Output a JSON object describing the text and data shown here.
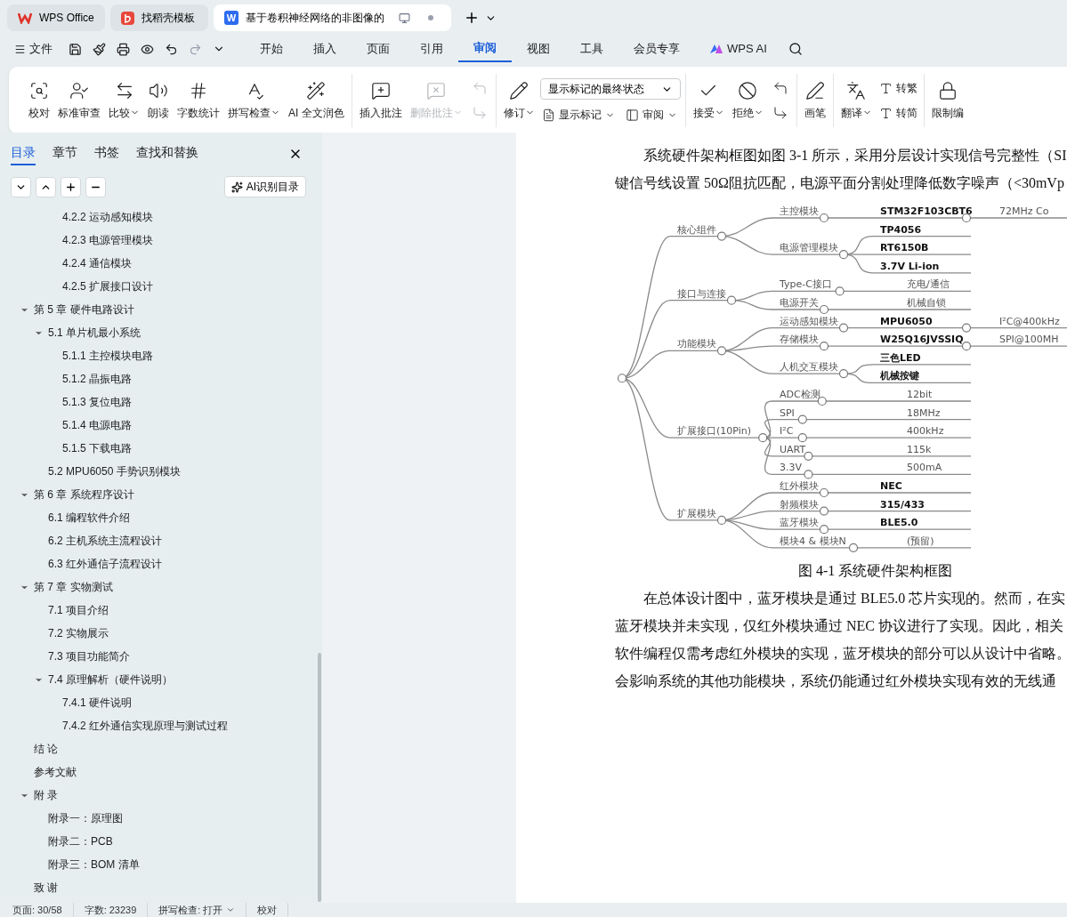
{
  "app_tabs": [
    {
      "kind": "wps",
      "label": "WPS Office",
      "selected": false
    },
    {
      "kind": "template",
      "label": "找稻壳模板",
      "selected": false
    },
    {
      "kind": "doc",
      "badge": "W",
      "label": "基于卷积神经网络的非图像的",
      "selected": true
    }
  ],
  "menu": {
    "file": "文件",
    "items": [
      {
        "label": "开始",
        "selected": false
      },
      {
        "label": "插入",
        "selected": false
      },
      {
        "label": "页面",
        "selected": false
      },
      {
        "label": "引用",
        "selected": false
      },
      {
        "label": "审阅",
        "selected": true
      },
      {
        "label": "视图",
        "selected": false
      },
      {
        "label": "工具",
        "selected": false
      },
      {
        "label": "会员专享",
        "selected": false
      }
    ],
    "ai": "WPS AI"
  },
  "ribbon": [
    {
      "items": [
        {
          "kind": "large",
          "label": "校对",
          "dropdown": false,
          "disabled": false
        },
        {
          "kind": "large",
          "label": "标准审查",
          "dropdown": false,
          "disabled": false
        },
        {
          "kind": "large",
          "label": "比较",
          "dropdown": true,
          "disabled": false
        },
        {
          "kind": "large",
          "label": "朗读",
          "dropdown": false,
          "disabled": false
        },
        {
          "kind": "large",
          "label": "字数统计",
          "dropdown": false,
          "disabled": false
        },
        {
          "kind": "large",
          "label": "拼写检查",
          "dropdown": true,
          "disabled": false
        },
        {
          "kind": "large",
          "label": "AI 全文润色",
          "dropdown": false,
          "disabled": false
        }
      ]
    },
    {
      "items": [
        {
          "kind": "large",
          "label": "插入批注",
          "dropdown": false,
          "disabled": false
        },
        {
          "kind": "large",
          "label": "删除批注",
          "dropdown": true,
          "disabled": true
        },
        {
          "kind": "pair",
          "disabled": true
        }
      ]
    },
    {
      "items": [
        {
          "kind": "large",
          "label": "修订",
          "dropdown": true,
          "disabled": false
        },
        {
          "kind": "select",
          "value": "显示标记的最终状态",
          "buttons": [
            {
              "label": "显示标记",
              "dropdown": true
            },
            {
              "label": "审阅",
              "dropdown": true
            }
          ]
        }
      ]
    },
    {
      "items": [
        {
          "kind": "large",
          "label": "接受",
          "dropdown": true,
          "disabled": false
        },
        {
          "kind": "large",
          "label": "拒绝",
          "dropdown": true,
          "disabled": false
        },
        {
          "kind": "pair",
          "disabled": false
        }
      ]
    },
    {
      "items": [
        {
          "kind": "large",
          "label": "画笔",
          "dropdown": false,
          "disabled": false
        }
      ]
    },
    {
      "items": [
        {
          "kind": "large",
          "label": "翻译",
          "dropdown": true,
          "disabled": false
        },
        {
          "kind": "stack",
          "buttons": [
            {
              "label": "转繁",
              "dropdown": false
            },
            {
              "label": "转简",
              "dropdown": false
            }
          ]
        }
      ]
    },
    {
      "items": [
        {
          "kind": "large",
          "label": "限制编",
          "dropdown": false,
          "disabled": false
        }
      ]
    }
  ],
  "sidebar": {
    "tabs": [
      {
        "label": "目录",
        "selected": true
      },
      {
        "label": "章节",
        "selected": false
      },
      {
        "label": "书签",
        "selected": false
      },
      {
        "label": "查找和替换",
        "selected": false
      }
    ],
    "ai_button": "AI识别目录",
    "leading_items": [
      {
        "label": "4.2.2  运动感知模块"
      },
      {
        "label": "4.2.3  电源管理模块"
      },
      {
        "label": "4.2.4  通信模块"
      },
      {
        "label": "4.2.5  扩展接口设计"
      }
    ],
    "items": [
      {
        "label": "第 5 章  硬件电路设计",
        "expanded": true,
        "children": [
          {
            "label": "5.1 单片机最小系统",
            "expanded": true,
            "children": [
              {
                "label": "5.1.1  主控模块电路"
              },
              {
                "label": "5.1.2  晶振电路"
              },
              {
                "label": "5.1.3  复位电路"
              },
              {
                "label": "5.1.4  电源电路"
              },
              {
                "label": "5.1.5 下载电路"
              }
            ]
          },
          {
            "label": "5.2 MPU6050 手势识别模块"
          }
        ]
      },
      {
        "label": "第 6 章  系统程序设计",
        "expanded": true,
        "children": [
          {
            "label": "6.1  编程软件介绍"
          },
          {
            "label": "6.2  主机系统主流程设计"
          },
          {
            "label": "6.3  红外通信子流程设计"
          }
        ]
      },
      {
        "label": "第 7 章  实物测试",
        "expanded": true,
        "children": [
          {
            "label": "7.1  项目介绍"
          },
          {
            "label": "7.2  实物展示"
          },
          {
            "label": "7.3  项目功能简介"
          },
          {
            "label": "7.4  原理解析（硬件说明）",
            "expanded": true,
            "children": [
              {
                "label": "7.4.1 硬件说明"
              },
              {
                "label": "7.4.2 红外通信实现原理与测试过程"
              }
            ]
          }
        ]
      },
      {
        "label": "结   论"
      },
      {
        "label": "参考文献"
      },
      {
        "label": "附   录",
        "expanded": true,
        "children": [
          {
            "label": "附录一：原理图"
          },
          {
            "label": "附录二：PCB"
          },
          {
            "label": "附录三：BOM 清单"
          }
        ]
      },
      {
        "label": "致   谢"
      }
    ]
  },
  "document": {
    "para1": [
      "系统硬件架构框图如图 3-1 所示，采用分层设计实现信号完整性（SI",
      "键信号线设置 50Ω阻抗匹配，电源平面分割处理降低数字噪声（<30mVp"
    ],
    "mindmap": {
      "children": [
        {
          "label": "核心组件",
          "children": [
            {
              "label": "主控模块",
              "children": [
                {
                  "label": "STM32F103CBT6",
                  "bold": true,
                  "children": [
                    {
                      "label": "72MHz Co",
                      "bold": false
                    }
                  ]
                }
              ]
            },
            {
              "label": "电源管理模块",
              "children": [
                {
                  "label": "TP4056",
                  "bold": true
                },
                {
                  "label": "RT6150B",
                  "bold": true
                },
                {
                  "label": "3.7V Li-ion",
                  "bold": true
                }
              ]
            }
          ]
        },
        {
          "label": "接口与连接",
          "children": [
            {
              "label": "Type-C接口",
              "children": [
                {
                  "label": "充电/通信",
                  "bold": false
                }
              ]
            },
            {
              "label": "电源开关",
              "children": [
                {
                  "label": "机械自锁",
                  "bold": false
                }
              ]
            }
          ]
        },
        {
          "label": "功能模块",
          "children": [
            {
              "label": "运动感知模块",
              "children": [
                {
                  "label": "MPU6050",
                  "bold": true,
                  "children": [
                    {
                      "label": "I²C@400kHz",
                      "bold": false
                    }
                  ]
                }
              ]
            },
            {
              "label": "存储模块",
              "children": [
                {
                  "label": "W25Q16JVSSIQ",
                  "bold": true,
                  "children": [
                    {
                      "label": "SPI@100MH",
                      "bold": false
                    }
                  ]
                }
              ]
            },
            {
              "label": "人机交互模块",
              "children": [
                {
                  "label": "三色LED",
                  "bold": true
                },
                {
                  "label": "机械按键",
                  "bold": true
                }
              ]
            }
          ]
        },
        {
          "label": "扩展接口(10Pin)",
          "children": [
            {
              "label": "ADC检测",
              "children": [
                {
                  "label": "12bit",
                  "bold": false
                }
              ]
            },
            {
              "label": "SPI",
              "children": [
                {
                  "label": "18MHz",
                  "bold": false
                }
              ]
            },
            {
              "label": "I²C",
              "children": [
                {
                  "label": "400kHz",
                  "bold": false
                }
              ]
            },
            {
              "label": "UART",
              "children": [
                {
                  "label": "115k",
                  "bold": false
                }
              ]
            },
            {
              "label": "3.3V",
              "children": [
                {
                  "label": "500mA",
                  "bold": false
                }
              ]
            }
          ]
        },
        {
          "label": "扩展模块",
          "children": [
            {
              "label": "红外模块",
              "children": [
                {
                  "label": "NEC",
                  "bold": true
                }
              ]
            },
            {
              "label": "射频模块",
              "children": [
                {
                  "label": "315/433",
                  "bold": true
                }
              ]
            },
            {
              "label": "蓝牙模块",
              "children": [
                {
                  "label": "BLE5.0",
                  "bold": true
                }
              ]
            },
            {
              "label": "模块4 & 模块N",
              "children": [
                {
                  "label": "(预留)",
                  "bold": false
                }
              ]
            }
          ]
        }
      ]
    },
    "caption": "图 4-1  系统硬件架构框图",
    "para2": [
      "在总体设计图中，蓝牙模块是通过 BLE5.0 芯片实现的。然而，在实",
      "蓝牙模块并未实现，仅红外模块通过 NEC 协议进行了实现。因此，相关",
      "软件编程仅需考虑红外模块的实现，蓝牙模块的部分可以从设计中省略。",
      "会影响系统的其他功能模块，系统仍能通过红外模块实现有效的无线通"
    ]
  },
  "status_bar": [
    {
      "label": "页面: 30/58",
      "dropdown": false
    },
    {
      "label": "字数: 23239",
      "dropdown": false
    },
    {
      "label": "拼写检查: 打开",
      "dropdown": true
    },
    {
      "label": "校对",
      "dropdown": false
    }
  ]
}
